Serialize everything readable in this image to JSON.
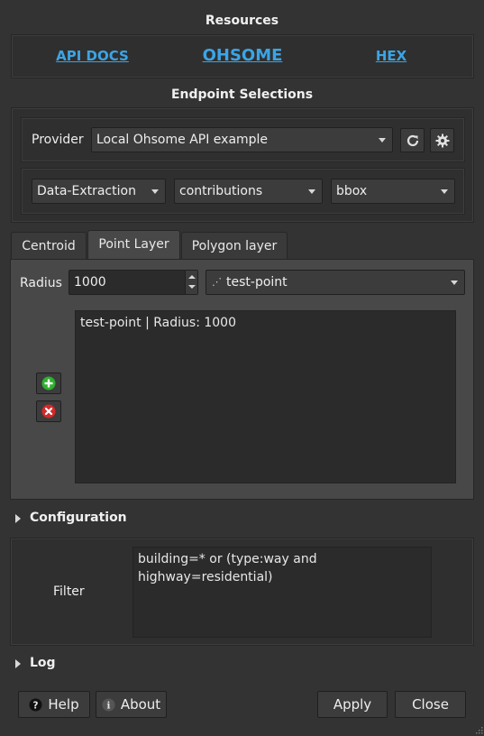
{
  "resources": {
    "title": "Resources",
    "links": [
      "API DOCS",
      "OHSOME",
      "HEX"
    ]
  },
  "endpoint": {
    "title": "Endpoint Selections",
    "provider_label": "Provider",
    "provider_value": "Local Ohsome API example",
    "selects": [
      "Data-Extraction",
      "contributions",
      "bbox"
    ]
  },
  "tabs": [
    "Centroid",
    "Point Layer",
    "Polygon layer"
  ],
  "point_layer": {
    "radius_label": "Radius",
    "radius_value": "1000",
    "layer_value": "test-point",
    "list_items": [
      "test-point | Radius: 1000"
    ]
  },
  "configuration": {
    "label": "Configuration",
    "filter_label": "Filter",
    "filter_value": "building=* or (type:way and highway=residential)"
  },
  "log": {
    "label": "Log"
  },
  "footer": {
    "help": "Help",
    "about": "About",
    "apply": "Apply",
    "close": "Close"
  },
  "colors": {
    "background": "#333333",
    "link": "#3aa5e6",
    "panel": "#484848",
    "add_icon": "#2fb02f",
    "remove_icon": "#d42a2a"
  },
  "icons": [
    "refresh-icon",
    "gear-icon",
    "plus-icon",
    "remove-icon",
    "question-icon",
    "info-icon",
    "point-layer-icon",
    "chevron-right-icon",
    "resize-grip-icon"
  ]
}
